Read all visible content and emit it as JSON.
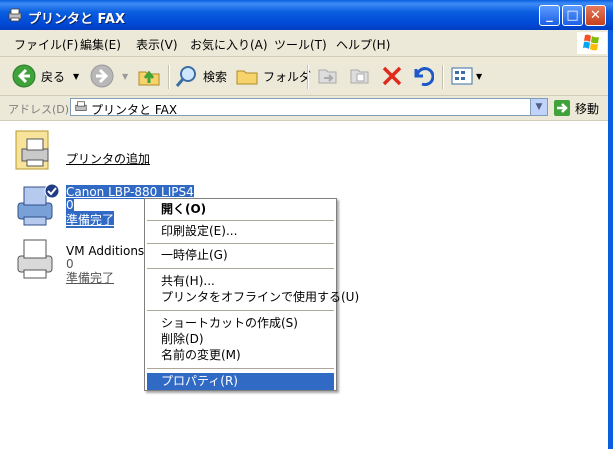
{
  "window": {
    "title": "プリンタと FAX",
    "min_label": "_",
    "max_label": "□",
    "close_label": "✕"
  },
  "menubar": [
    "ファイル(F)",
    "編集(E)",
    "表示(V)",
    "お気に入り(A)",
    "ツール(T)",
    "ヘルプ(H)"
  ],
  "toolbar": {
    "back_label": "戻る",
    "search_label": "検索",
    "folder_label": "フォルダ"
  },
  "address": {
    "label": "アドレス(D)",
    "value": "プリンタと FAX",
    "go_label": "移動"
  },
  "items": {
    "add_printer": {
      "label": "プリンタの追加"
    },
    "canon": {
      "name": "Canon LBP-880 LIPS4",
      "jobs": "0",
      "status": "準備完了"
    },
    "vm": {
      "name": "VM Additions P",
      "jobs": "0",
      "status": "準備完了"
    }
  },
  "context_menu": {
    "open": "開く(O)",
    "printing_prefs": "印刷設定(E)...",
    "pause": "一時停止(G)",
    "sharing": "共有(H)...",
    "offline": "プリンタをオフラインで使用する(U)",
    "create_shortcut": "ショートカットの作成(S)",
    "delete": "削除(D)",
    "rename": "名前の変更(M)",
    "properties": "プロパティ(R)"
  },
  "colors": {
    "title_blue": "#0a5fe0",
    "selection": "#316ac5",
    "chrome": "#ece9d8"
  }
}
